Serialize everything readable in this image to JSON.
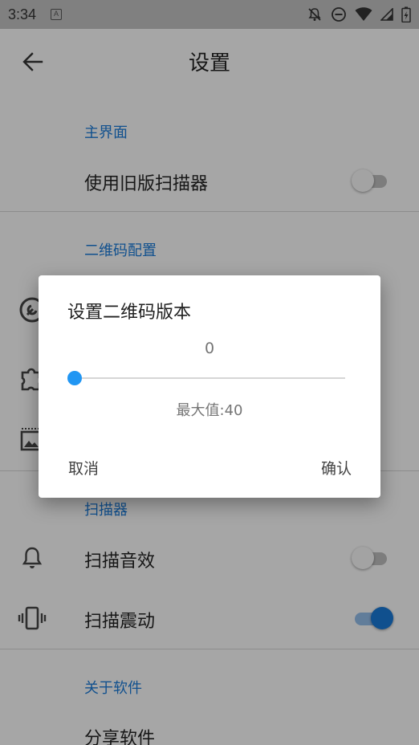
{
  "status_bar": {
    "time": "3:34",
    "notification_badge": "A",
    "icons": [
      "notifications-off-icon",
      "do-not-disturb-icon",
      "wifi-icon",
      "cellular-signal-icon",
      "battery-charging-icon"
    ]
  },
  "app_bar": {
    "title": "设置",
    "back_icon": "arrow-back-icon"
  },
  "sections": {
    "main_ui": {
      "header": "主界面",
      "use_old_scanner": {
        "label": "使用旧版扫描器",
        "enabled": false
      }
    },
    "qr_config": {
      "header": "二维码配置",
      "icons": [
        "wrench-icon",
        "puzzle-icon",
        "image-icon"
      ]
    },
    "scanner": {
      "header": "扫描器",
      "scan_sound": {
        "label": "扫描音效",
        "enabled": false,
        "icon": "bell-icon"
      },
      "scan_vibrate": {
        "label": "扫描震动",
        "enabled": true,
        "icon": "vibrate-icon"
      }
    },
    "about": {
      "header": "关于软件",
      "share": {
        "label": "分享软件"
      }
    }
  },
  "dialog": {
    "title": "设置二维码版本",
    "current_value": "0",
    "max_label": "最大值:40",
    "slider": {
      "value": 0,
      "min": 0,
      "max": 40
    },
    "cancel_label": "取消",
    "confirm_label": "确认"
  },
  "colors": {
    "accent": "#1976d2",
    "slider_accent": "#2196f3"
  }
}
